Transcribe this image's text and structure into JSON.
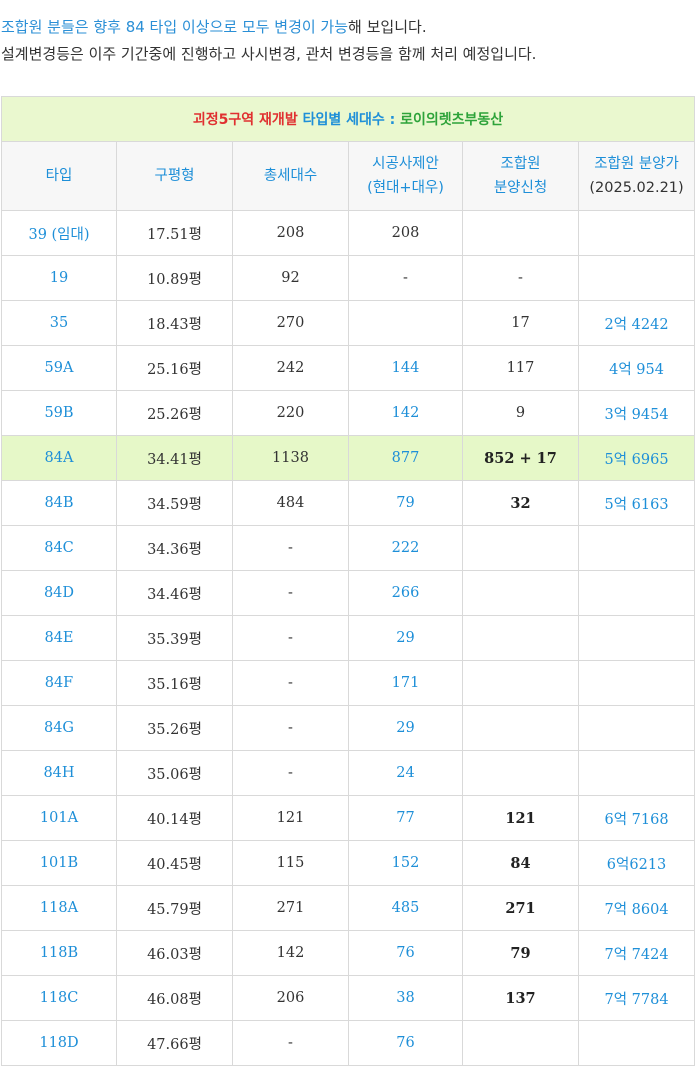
{
  "intro": {
    "line1_blue": "조합원 분들은 향후 84 타입 이상으로 모두 변경이 가능",
    "line1_rest": "해 보입니다.",
    "line2": "설계변경등은 이주 기간중에 진행하고 사시변경, 관처 변경등을 함께 처리 예정입니다."
  },
  "table": {
    "title_red": "괴정5구역 재개발",
    "title_blue": "타입별 세대수 :",
    "title_green": "로이의렛츠부동산",
    "headers": {
      "type": "타입",
      "pyeong": "구평형",
      "total": "총세대수",
      "proposal_1": "시공사제안",
      "proposal_2": "(현대+대우)",
      "member_1": "조합원",
      "member_2": "분양신청",
      "price_1": "조합원 분양가",
      "price_2": "(2025.02.21)"
    },
    "rows": [
      {
        "type": "39 (임대)",
        "pyeong": "17.51평",
        "total": "208",
        "proposal": "208",
        "member": "",
        "price": ""
      },
      {
        "type": "19",
        "pyeong": "10.89평",
        "total": "92",
        "proposal": "-",
        "member": "-",
        "price": ""
      },
      {
        "type": "35",
        "pyeong": "18.43평",
        "total": "270",
        "proposal": "",
        "member": "17",
        "price": "2억 4242"
      },
      {
        "type": "59A",
        "pyeong": "25.16평",
        "total": "242",
        "proposal": "144",
        "member": "117",
        "price": "4억 954"
      },
      {
        "type": "59B",
        "pyeong": "25.26평",
        "total": "220",
        "proposal": "142",
        "member": "9",
        "price": "3억 9454"
      },
      {
        "type": "84A",
        "pyeong": "34.41평",
        "total": "1138",
        "proposal": "877",
        "member": "852 + 17",
        "price": "5억 6965",
        "highlight": true
      },
      {
        "type": "84B",
        "pyeong": "34.59평",
        "total": "484",
        "proposal": "79",
        "member": "32",
        "price": "5억 6163"
      },
      {
        "type": "84C",
        "pyeong": "34.36평",
        "total": "-",
        "proposal": "222",
        "member": "",
        "price": ""
      },
      {
        "type": "84D",
        "pyeong": "34.46평",
        "total": "-",
        "proposal": "266",
        "member": "",
        "price": ""
      },
      {
        "type": "84E",
        "pyeong": "35.39평",
        "total": "-",
        "proposal": "29",
        "member": "",
        "price": ""
      },
      {
        "type": "84F",
        "pyeong": "35.16평",
        "total": "-",
        "proposal": "171",
        "member": "",
        "price": ""
      },
      {
        "type": "84G",
        "pyeong": "35.26평",
        "total": "-",
        "proposal": "29",
        "member": "",
        "price": ""
      },
      {
        "type": "84H",
        "pyeong": "35.06평",
        "total": "-",
        "proposal": "24",
        "member": "",
        "price": ""
      },
      {
        "type": "101A",
        "pyeong": "40.14평",
        "total": "121",
        "proposal": "77",
        "member": "121",
        "price": "6억 7168"
      },
      {
        "type": "101B",
        "pyeong": "40.45평",
        "total": "115",
        "proposal": "152",
        "member": "84",
        "price": "6억6213"
      },
      {
        "type": "118A",
        "pyeong": "45.79평",
        "total": "271",
        "proposal": "485",
        "member": "271",
        "price": "7억 8604"
      },
      {
        "type": "118B",
        "pyeong": "46.03평",
        "total": "142",
        "proposal": "76",
        "member": "79",
        "price": "7억 7424"
      },
      {
        "type": "118C",
        "pyeong": "46.08평",
        "total": "206",
        "proposal": "38",
        "member": "137",
        "price": "7억 7784"
      },
      {
        "type": "118D",
        "pyeong": "47.66평",
        "total": "-",
        "proposal": "76",
        "member": "",
        "price": ""
      }
    ]
  }
}
